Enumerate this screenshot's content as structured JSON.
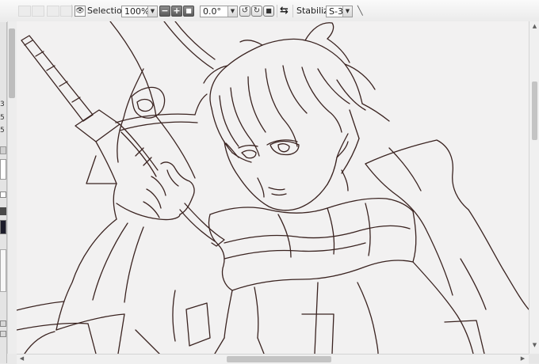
{
  "toolbar": {
    "selection_label": "Selection",
    "zoom": "100%",
    "zoom_out": "−",
    "zoom_in": "+",
    "zoom_reset": "■",
    "rotation": "0.0°",
    "rotate_left": "↺",
    "rotate_right": "↻",
    "rotate_reset": "■",
    "flip": "⇆",
    "stabilizer_label": "Stabilizer",
    "stabilizer_value": "S-3",
    "pen_icon": "╲",
    "dropdown_glyph": "▼",
    "eye_icon": "👁"
  },
  "left_panel": {
    "values": [
      "3",
      "5",
      "5"
    ]
  },
  "colors": {
    "line": "#3a2320",
    "paper": "#f2f1f1",
    "chrome": "#e9e9e9"
  },
  "scroll": {
    "up_arrow": "▲",
    "down_arrow": "▼",
    "left_arrow": "◀",
    "right_arrow": "▶"
  }
}
